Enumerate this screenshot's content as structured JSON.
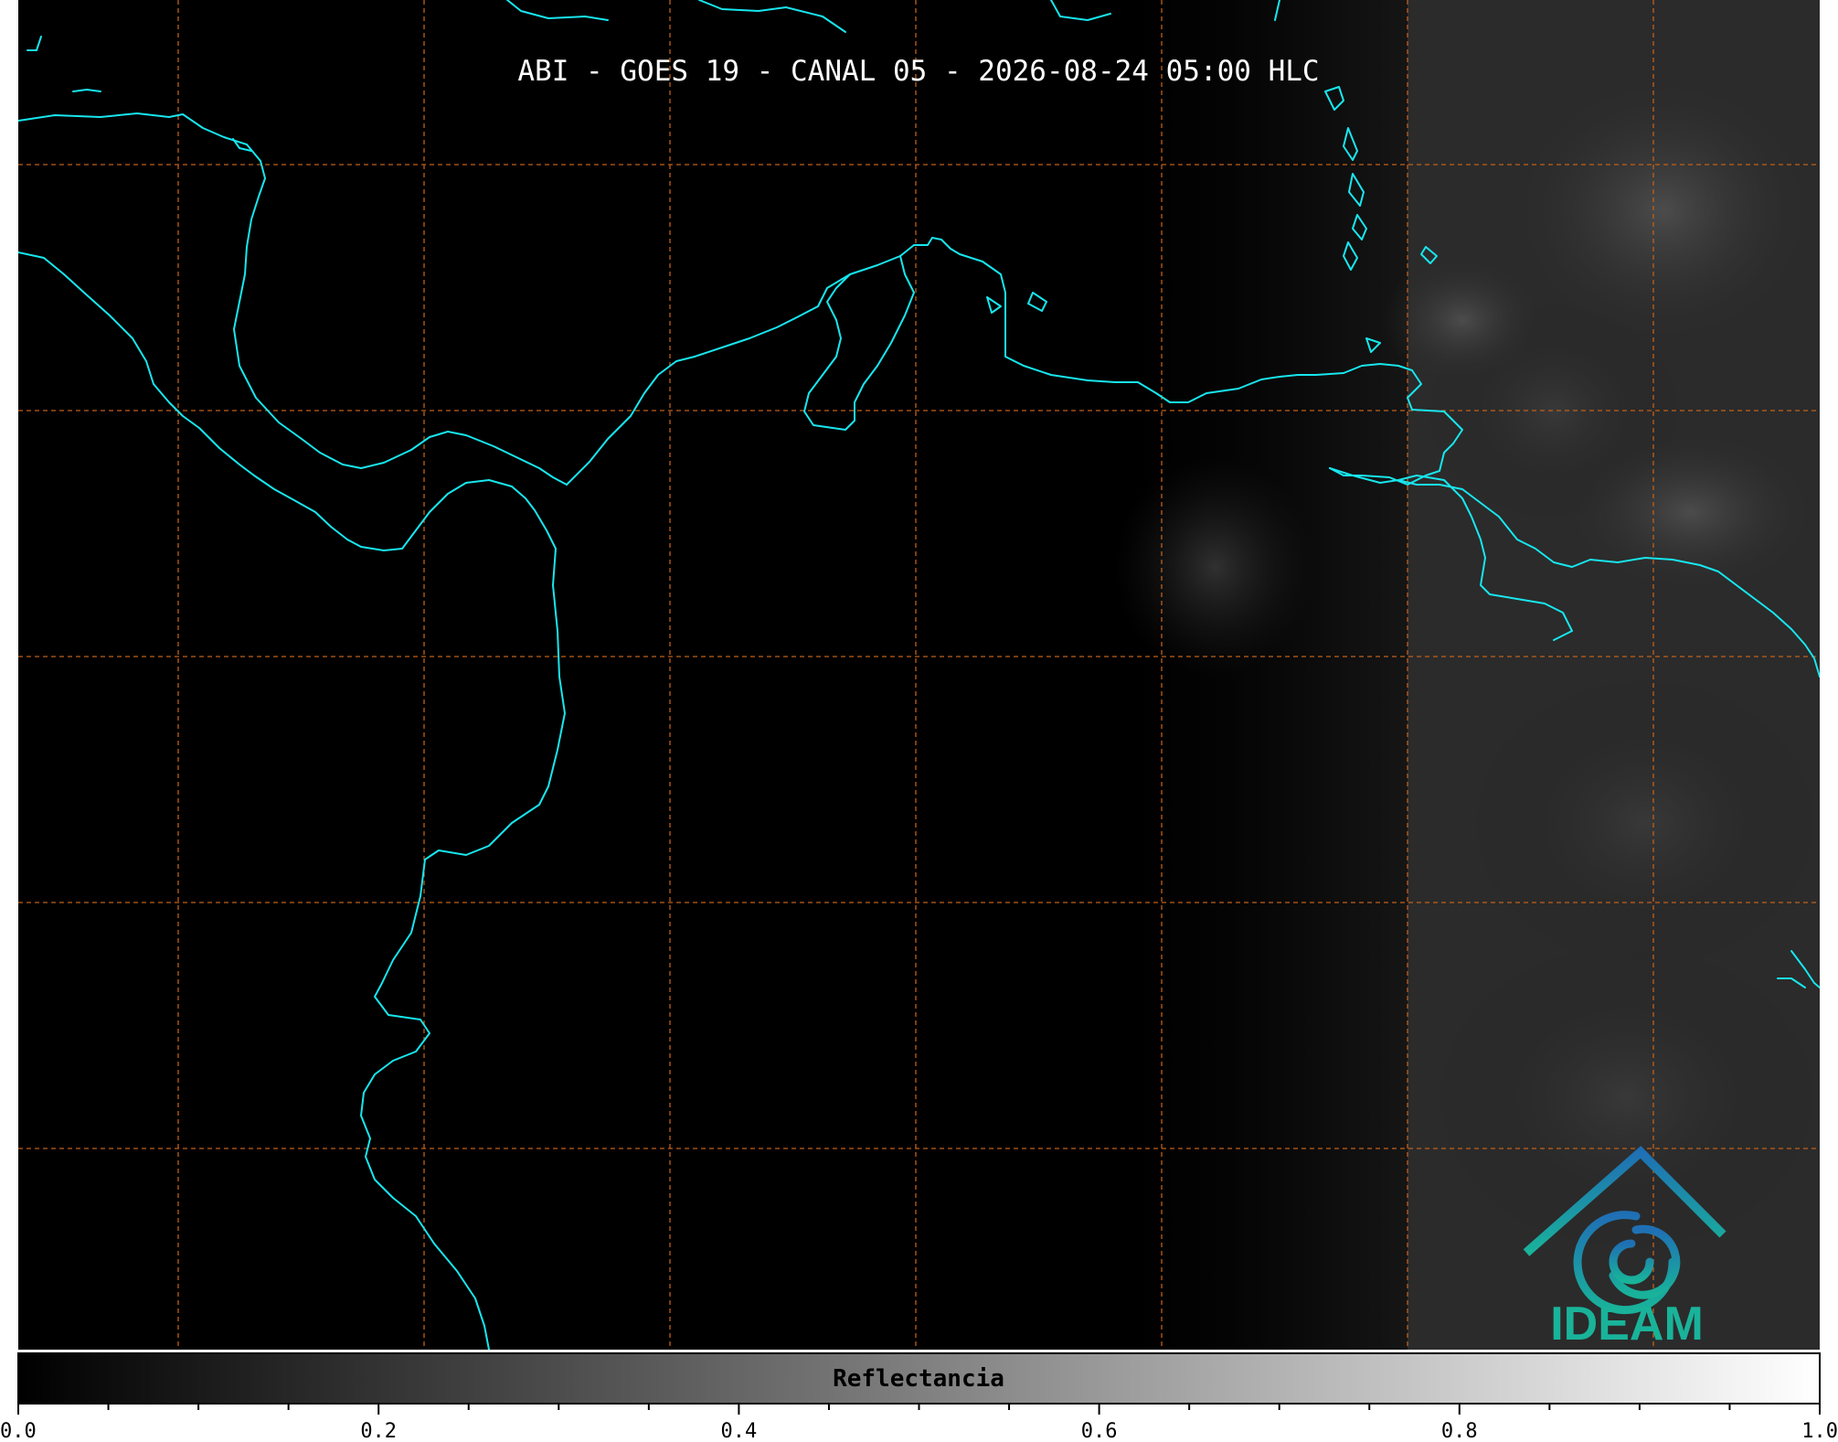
{
  "map": {
    "title": "ABI - GOES 19 - CANAL 05 - 2026-08-24 05:00 HLC",
    "logo_text": "IDEAM",
    "colors": {
      "background": "#000000",
      "coastline": "#18e6ee",
      "graticule": "#c0601a",
      "logo_blue": "#1f6fb4",
      "logo_teal": "#19b39a"
    }
  },
  "colorbar": {
    "label": "Reflectancia",
    "ticks": [
      "0.0",
      "0.2",
      "0.4",
      "0.6",
      "0.8",
      "1.0"
    ],
    "min": 0.0,
    "max": 1.0,
    "colormap": "grayscale black-to-white"
  }
}
